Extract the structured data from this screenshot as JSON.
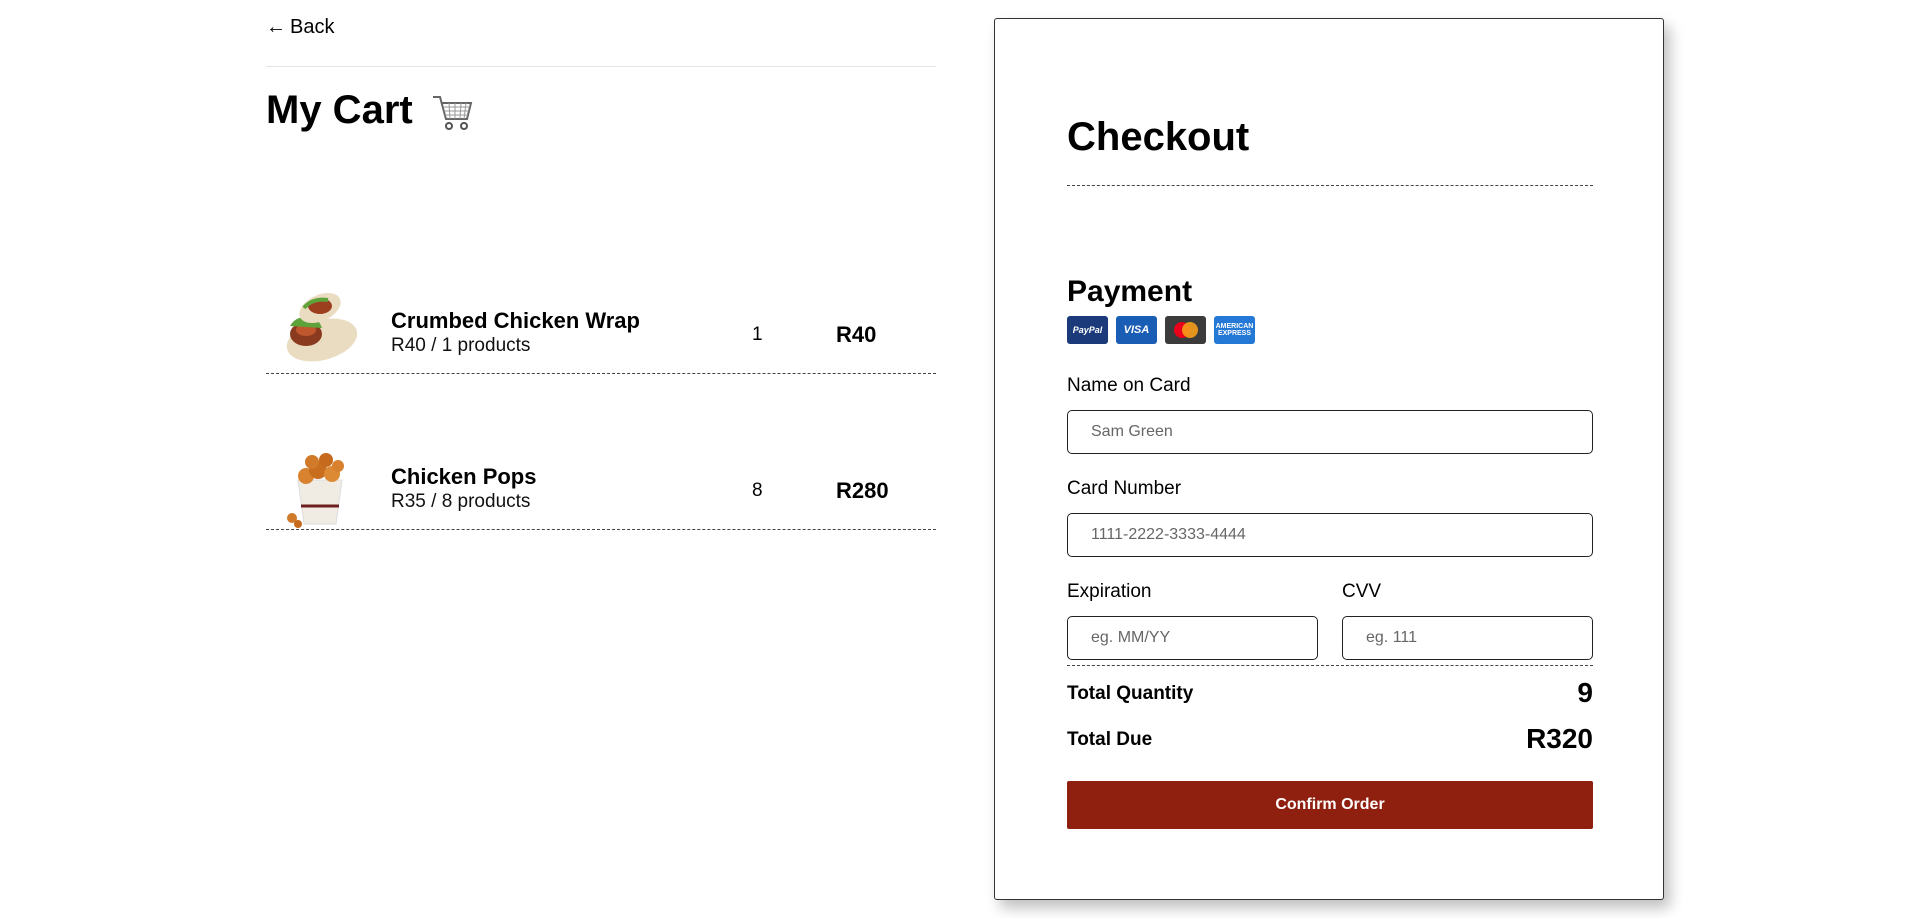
{
  "nav": {
    "back_label": "Back"
  },
  "cart": {
    "title": "My Cart",
    "items": [
      {
        "name": "Crumbed Chicken Wrap",
        "sub": "R40 / 1 products",
        "qty": "1",
        "price": "R40"
      },
      {
        "name": "Chicken Pops",
        "sub": "R35 / 8 products",
        "qty": "8",
        "price": "R280"
      }
    ]
  },
  "checkout": {
    "title": "Checkout",
    "payment_title": "Payment",
    "card_icons": [
      "paypal-icon",
      "visa-icon",
      "mastercard-icon",
      "amex-icon"
    ],
    "card_labels": {
      "paypal": "PayPal",
      "visa": "VISA",
      "amex": "AMERICAN EXPRESS"
    },
    "name_label": "Name on Card",
    "name_placeholder": "Sam Green",
    "number_label": "Card Number",
    "number_placeholder": "1111-2222-3333-4444",
    "expiration_label": "Expiration",
    "expiration_placeholder": "eg. MM/YY",
    "cvv_label": "CVV",
    "cvv_placeholder": "eg. 111",
    "total_quantity_label": "Total Quantity",
    "total_quantity_value": "9",
    "total_due_label": "Total Due",
    "total_due_value": "R320",
    "confirm_label": "Confirm Order"
  },
  "colors": {
    "accent": "#8f1f0f",
    "border": "#222222"
  }
}
